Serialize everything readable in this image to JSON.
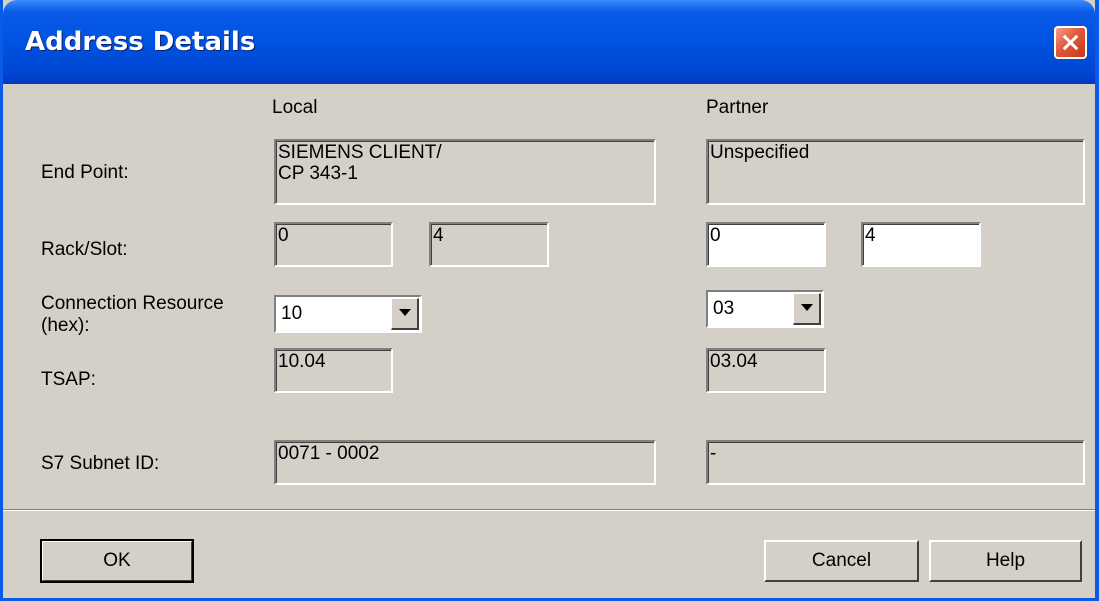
{
  "window": {
    "title": "Address Details"
  },
  "columns": {
    "local": "Local",
    "partner": "Partner"
  },
  "rows": {
    "end_point_label": "End Point:",
    "rack_slot_label": "Rack/Slot:",
    "conn_res_label": "Connection Resource\n(hex):",
    "tsap_label": "TSAP:",
    "subnet_label": "S7 Subnet ID:"
  },
  "local": {
    "end_point": "SIEMENS CLIENT/\nCP 343-1",
    "rack": "0",
    "slot": "4",
    "conn_resource": "10",
    "tsap": "10.04",
    "subnet_id": "0071 - 0002"
  },
  "partner": {
    "end_point": "Unspecified",
    "rack": "0",
    "slot": "4",
    "conn_resource": "03",
    "tsap": "03.04",
    "subnet_id": "-"
  },
  "buttons": {
    "ok": "OK",
    "cancel": "Cancel",
    "help": "Help"
  },
  "icons": {
    "close": "close-icon",
    "dropdown": "chevron-down-icon"
  }
}
